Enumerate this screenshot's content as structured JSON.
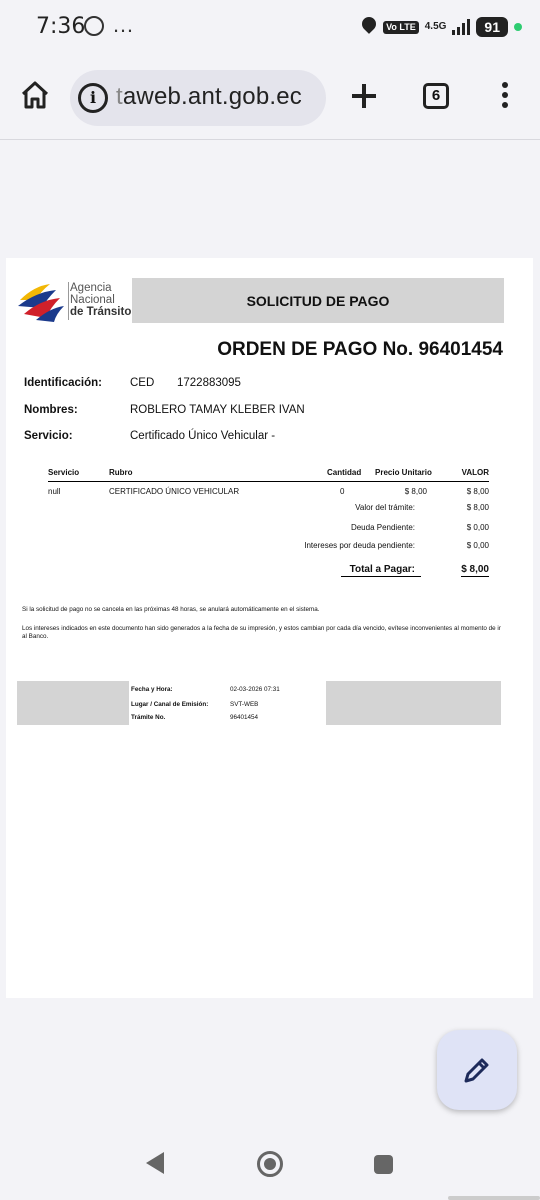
{
  "status_bar": {
    "time": "7:36",
    "dots": "…",
    "volte": "Vo LTE",
    "network": "4.5G",
    "battery": "91"
  },
  "browser": {
    "url_dim": "t",
    "url": "aweb.ant.gob.ec",
    "tab_count": "6"
  },
  "document": {
    "logo_lines": [
      "Agencia",
      "Nacional",
      "de Tránsito"
    ],
    "title": "SOLICITUD DE PAGO",
    "order_number": "ORDEN DE PAGO No. 96401454",
    "fields": {
      "identificacion_label": "Identificación:",
      "identificacion_type": "CED",
      "identificacion_value": "1722883095",
      "nombres_label": "Nombres:",
      "nombres_value": "ROBLERO TAMAY KLEBER IVAN",
      "servicio_label": "Servicio:",
      "servicio_value": "Certificado Único Vehicular -"
    },
    "table": {
      "headers": [
        "Servicio",
        "Rubro",
        "Cantidad",
        "Precio Unitario",
        "VALOR"
      ],
      "row": [
        "null",
        "CERTIFICADO ÚNICO VEHICULAR",
        "0",
        "$ 8,00",
        "$ 8,00"
      ]
    },
    "summary": {
      "valor_tramite_label": "Valor del trámite:",
      "valor_tramite": "$ 8,00",
      "deuda_label": "Deuda Pendiente:",
      "deuda": "$ 0,00",
      "intereses_label": "Intereses por deuda pendiente:",
      "intereses": "$ 0,00",
      "total_label": "Total a Pagar:",
      "total": "$ 8,00"
    },
    "notes": [
      "Si la solicitud de pago no se cancela en las próximas 48 horas, se anulará automáticamente en el sistema.",
      "Los intereses indicados en este documento han sido generados a la fecha de su impresión, y estos cambian por cada día vencido, evítese inconvenientes al momento de ir al Banco."
    ],
    "meta": {
      "fecha_label": "Fecha y Hora:",
      "fecha": "02-03-2026 07:31",
      "lugar_label": "Lugar / Canal de Emisión:",
      "lugar": "SVT-WEB",
      "tramite_label": "Trámite No.",
      "tramite": "96401454"
    }
  },
  "colors": {
    "logo_yellow": "#f2b705",
    "logo_blue": "#1b3a8c",
    "logo_red": "#d0202a",
    "fab_bg": "#dfe3f6",
    "gray_box": "#d4d4d4"
  }
}
